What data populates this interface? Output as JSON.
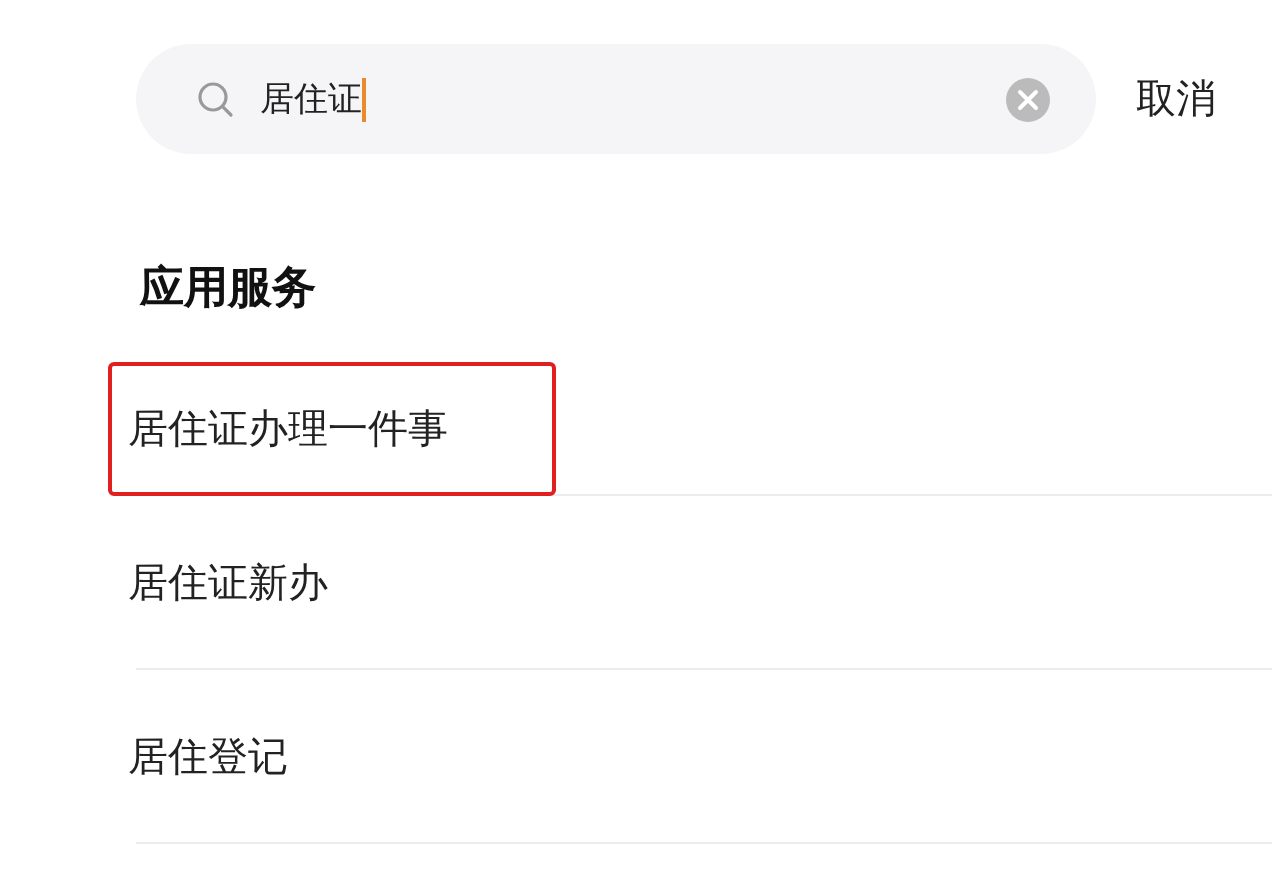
{
  "search": {
    "value": "居住证",
    "cancel": "取消"
  },
  "section": {
    "title": "应用服务"
  },
  "results": [
    {
      "label": "居住证办理一件事",
      "highlighted": true
    },
    {
      "label": "居住证新办",
      "highlighted": false
    },
    {
      "label": "居住登记",
      "highlighted": false
    }
  ]
}
